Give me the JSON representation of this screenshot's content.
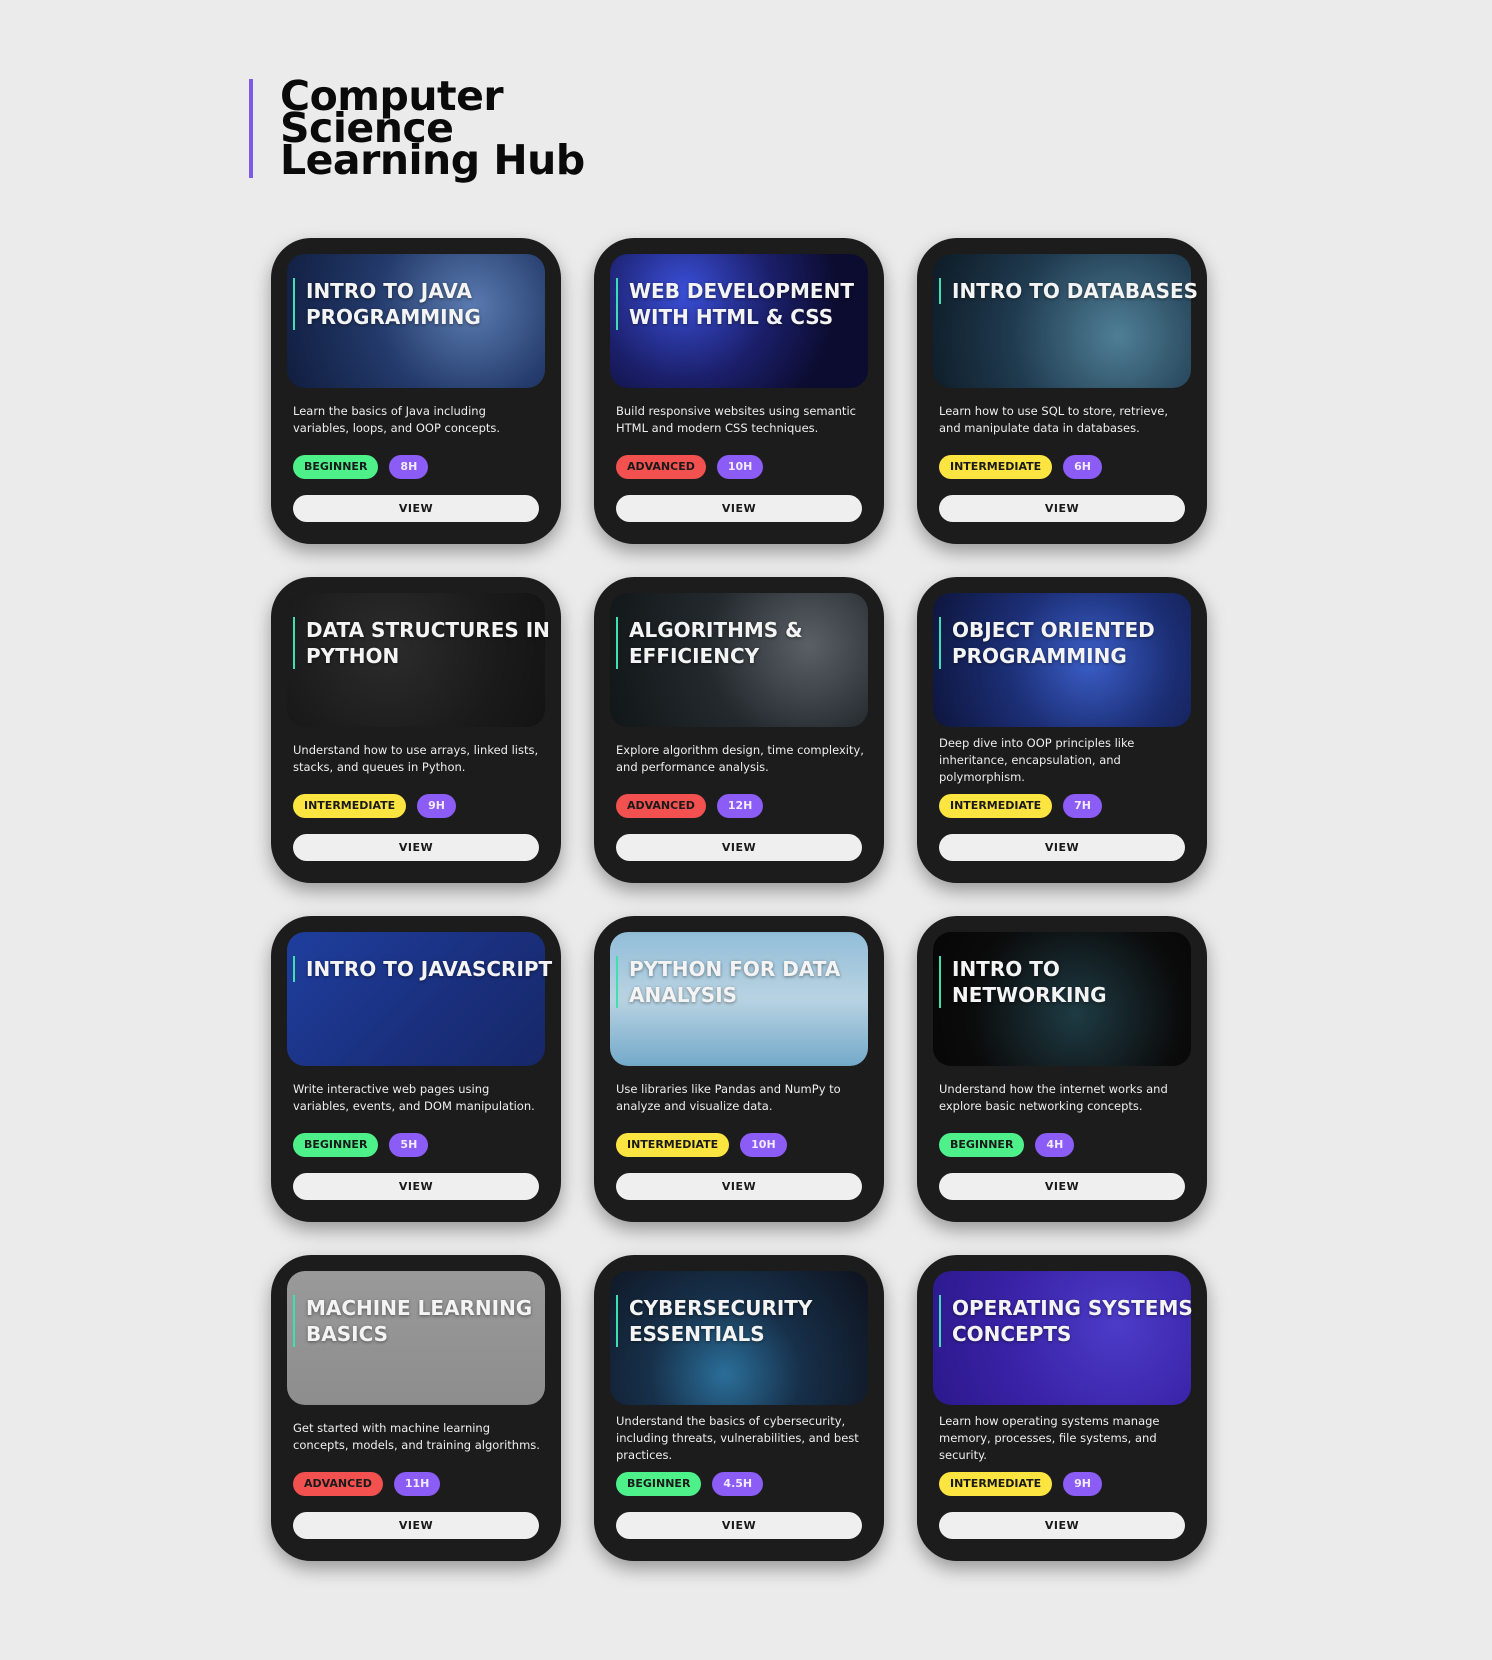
{
  "page": {
    "title": "Computer Science Learning Hub"
  },
  "colors": {
    "accent": "#7c5ce6",
    "title_bar": "#3fe0b0",
    "beginner": "#4ef08a",
    "advanced": "#f2514f",
    "intermediate": "#fde541",
    "hours": "#8b5cf6"
  },
  "courses": [
    {
      "title": "Intro to Java Programming",
      "description": "Learn the basics of Java including variables, loops, and OOP concepts.",
      "level": "BEGINNER",
      "duration": "8H",
      "button": "VIEW"
    },
    {
      "title": "Web Development with HTML & CSS",
      "description": "Build responsive websites using semantic HTML and modern CSS techniques.",
      "level": "ADVANCED",
      "duration": "10H",
      "button": "VIEW"
    },
    {
      "title": "Intro to Databases",
      "description": "Learn how to use SQL to store, retrieve, and manipulate data in databases.",
      "level": "INTERMEDIATE",
      "duration": "6H",
      "button": "VIEW"
    },
    {
      "title": "Data Structures in Python",
      "description": "Understand how to use arrays, linked lists, stacks, and queues in Python.",
      "level": "INTERMEDIATE",
      "duration": "9H",
      "button": "VIEW"
    },
    {
      "title": "Algorithms & Efficiency",
      "description": "Explore algorithm design, time complexity, and performance analysis.",
      "level": "ADVANCED",
      "duration": "12H",
      "button": "VIEW"
    },
    {
      "title": "Object Oriented Programming",
      "description": "Deep dive into OOP principles like inheritance, encapsulation, and polymorphism.",
      "level": "INTERMEDIATE",
      "duration": "7H",
      "button": "VIEW"
    },
    {
      "title": "Intro to JavaScript",
      "description": "Write interactive web pages using variables, events, and DOM manipulation.",
      "level": "BEGINNER",
      "duration": "5H",
      "button": "VIEW"
    },
    {
      "title": "Python for Data Analysis",
      "description": "Use libraries like Pandas and NumPy to analyze and visualize data.",
      "level": "INTERMEDIATE",
      "duration": "10H",
      "button": "VIEW"
    },
    {
      "title": "Intro to Networking",
      "description": "Understand how the internet works and explore basic networking concepts.",
      "level": "BEGINNER",
      "duration": "4H",
      "button": "VIEW"
    },
    {
      "title": "Machine Learning Basics",
      "description": "Get started with machine learning concepts, models, and training algorithms.",
      "level": "ADVANCED",
      "duration": "11H",
      "button": "VIEW"
    },
    {
      "title": "Cybersecurity Essentials",
      "description": "Understand the basics of cybersecurity, including threats, vulnerabilities, and best practices.",
      "level": "BEGINNER",
      "duration": "4.5H",
      "button": "VIEW"
    },
    {
      "title": "Operating Systems Concepts",
      "description": "Learn how operating systems manage memory, processes, file systems, and security.",
      "level": "INTERMEDIATE",
      "duration": "9H",
      "button": "VIEW"
    }
  ]
}
